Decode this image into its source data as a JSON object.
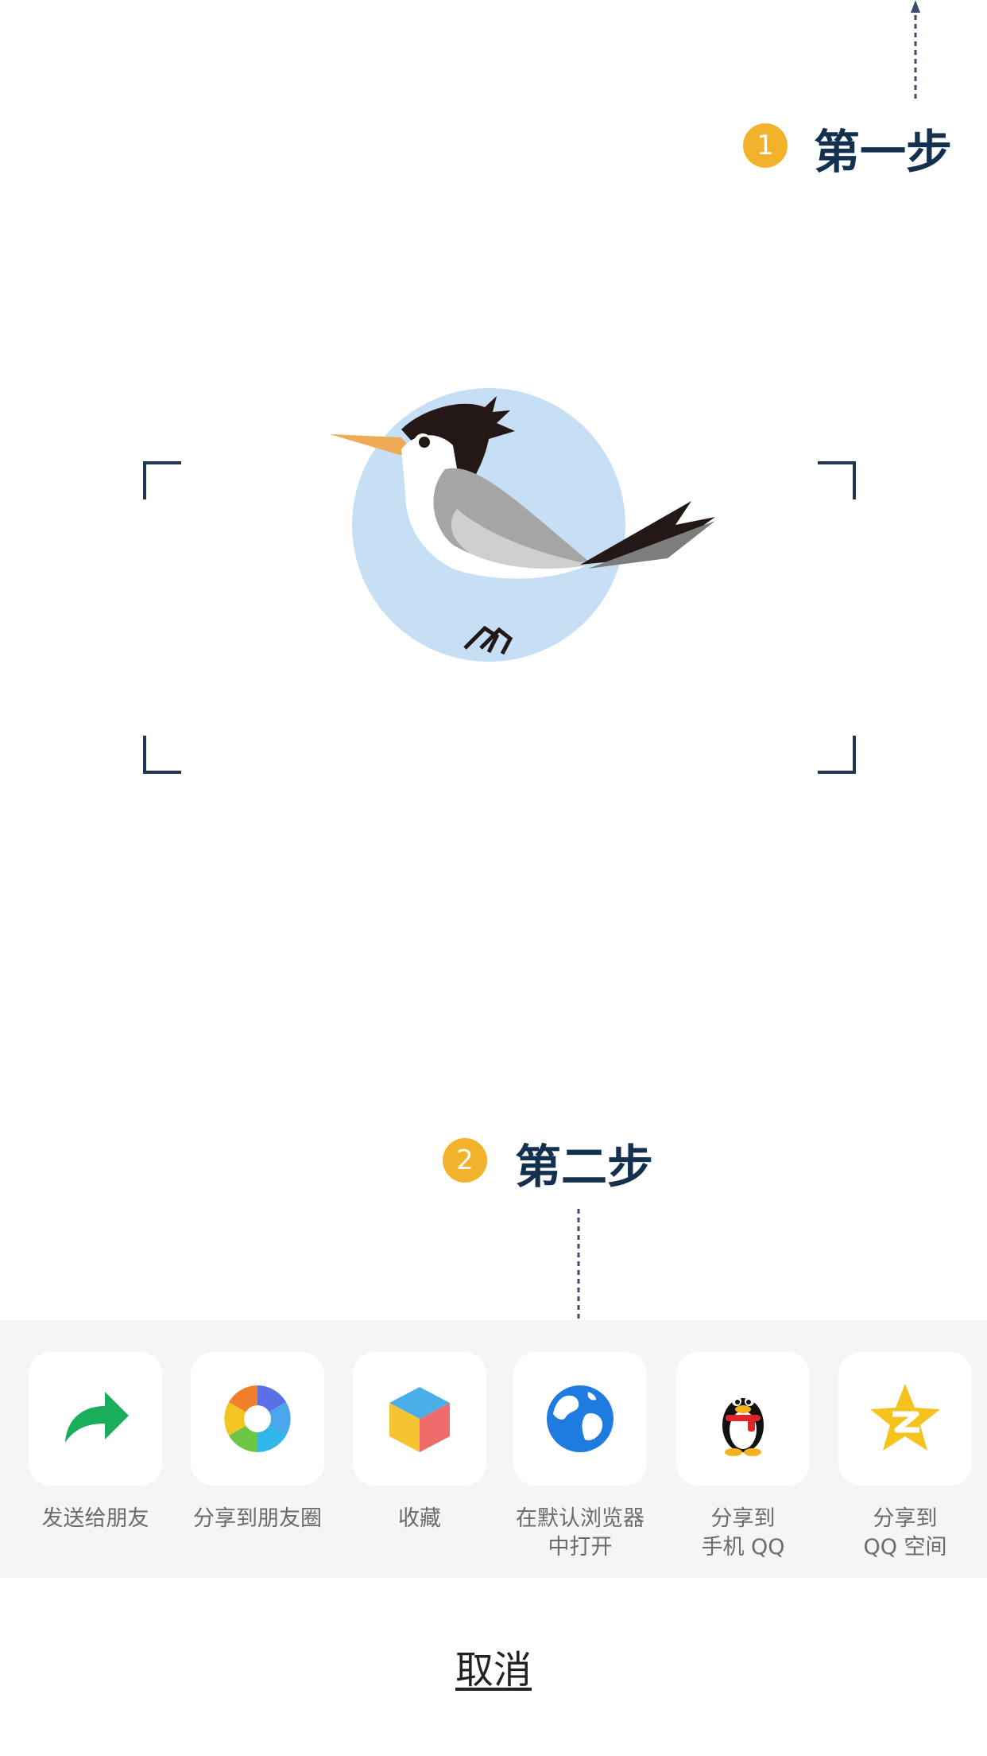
{
  "guide": {
    "step1": {
      "number": "1",
      "label": "第一步"
    },
    "step2": {
      "number": "2",
      "label": "第二步"
    }
  },
  "colors": {
    "badge": "#f3b22c",
    "step_text": "#14304f",
    "dashed_arrow": "#3b4d68",
    "panel_bg": "#f5f5f5",
    "bird_circle": "#c6dff4"
  },
  "share_sheet": {
    "items": [
      {
        "id": "friend",
        "icon": "share-arrow-icon",
        "label": "发送给朋友"
      },
      {
        "id": "moments",
        "icon": "moments-aperture-icon",
        "label": "分享到朋友圈"
      },
      {
        "id": "favorite",
        "icon": "favorite-cube-icon",
        "label": "收藏"
      },
      {
        "id": "browser",
        "icon": "globe-icon",
        "label": "在默认浏览器\n中打开"
      },
      {
        "id": "qq",
        "icon": "qq-penguin-icon",
        "label": "分享到\n手机 QQ"
      },
      {
        "id": "qzone",
        "icon": "qzone-star-icon",
        "label": "分享到\nQQ 空间"
      }
    ],
    "cancel_label": "取消"
  }
}
